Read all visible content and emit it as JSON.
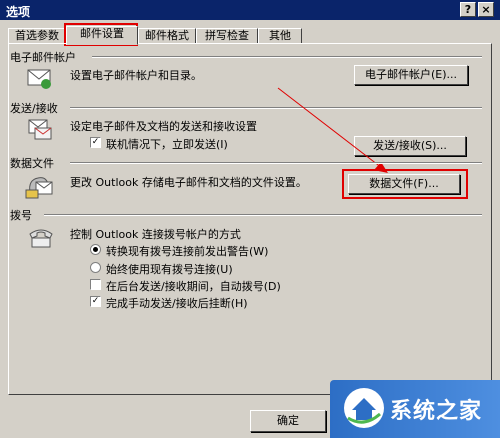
{
  "window": {
    "title": "选项",
    "help_btn": "?",
    "close_btn": "×"
  },
  "tabs": [
    {
      "label": "首选参数"
    },
    {
      "label": "邮件设置"
    },
    {
      "label": "邮件格式"
    },
    {
      "label": "拼写检查"
    },
    {
      "label": "其他"
    }
  ],
  "email_accounts": {
    "heading": "电子邮件帐户",
    "description": "设置电子邮件帐户和目录。",
    "button": "电子邮件帐户(E)..."
  },
  "send_receive": {
    "heading": "发送/接收",
    "description": "设定电子邮件及文档的发送和接收设置",
    "checkbox": "联机情况下，立即发送(I)",
    "checkbox_checked": true,
    "button": "发送/接收(S)..."
  },
  "data_files": {
    "heading": "数据文件",
    "description": "更改 Outlook 存储电子邮件和文档的文件设置。",
    "button": "数据文件(F)..."
  },
  "dialup": {
    "heading": "拨号",
    "description": "控制 Outlook 连接拨号帐户的方式",
    "options": [
      {
        "label": "转换现有拨号连接前发出警告(W)",
        "type": "radio",
        "checked": true
      },
      {
        "label": "始终使用现有拨号连接(U)",
        "type": "radio",
        "checked": false
      },
      {
        "label": "在后台发送/接收期间，自动拨号(D)",
        "type": "checkbox",
        "checked": false
      },
      {
        "label": "完成手动发送/接收后挂断(H)",
        "type": "checkbox",
        "checked": true
      }
    ]
  },
  "footer": {
    "ok_button": "确定"
  },
  "watermark": {
    "text": "系统之家"
  },
  "colors": {
    "highlight": "#e00000",
    "titlebar": "#0a246a",
    "face": "#d4d0c8"
  }
}
